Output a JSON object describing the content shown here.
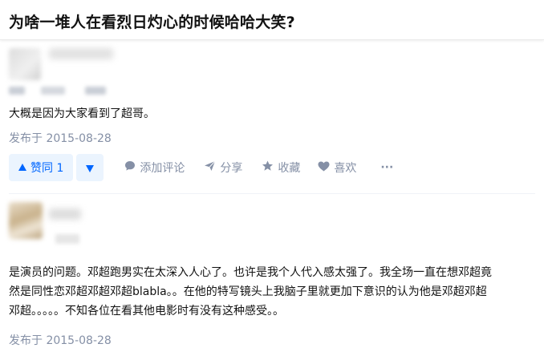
{
  "question": {
    "title": "为啥一堆人在看烈日灼心的时候哈哈大笑?"
  },
  "answers": [
    {
      "content": "大概是因为大家看到了超哥。",
      "date": "发布于 2015-08-28",
      "actions": {
        "vote_up_label": "赞同 1",
        "comment_label": "添加评论",
        "share_label": "分享",
        "collect_label": "收藏",
        "like_label": "喜欢",
        "more_label": "···"
      }
    },
    {
      "content_lines": [
        "是演员的问题。邓超跑男实在太深入人心了。也许是我个人代入感太强了。我全场一直在想邓超竟",
        "然是同性恋邓超邓超邓超blabla。。在他的特写镜头上我脑子里就更加下意识的认为他是邓超邓超",
        "邓超。。。。。不知各位在看其他电影时有没有这种感受。。"
      ],
      "date": "发布于 2015-08-28"
    }
  ],
  "colors": {
    "accent": "#0066ff",
    "accent_bg": "#ebf4fe",
    "meta": "#8590a6",
    "text": "#121212"
  },
  "icons": [
    "caret-up-icon",
    "caret-down-icon",
    "comment-icon",
    "share-icon",
    "star-icon",
    "heart-icon"
  ]
}
